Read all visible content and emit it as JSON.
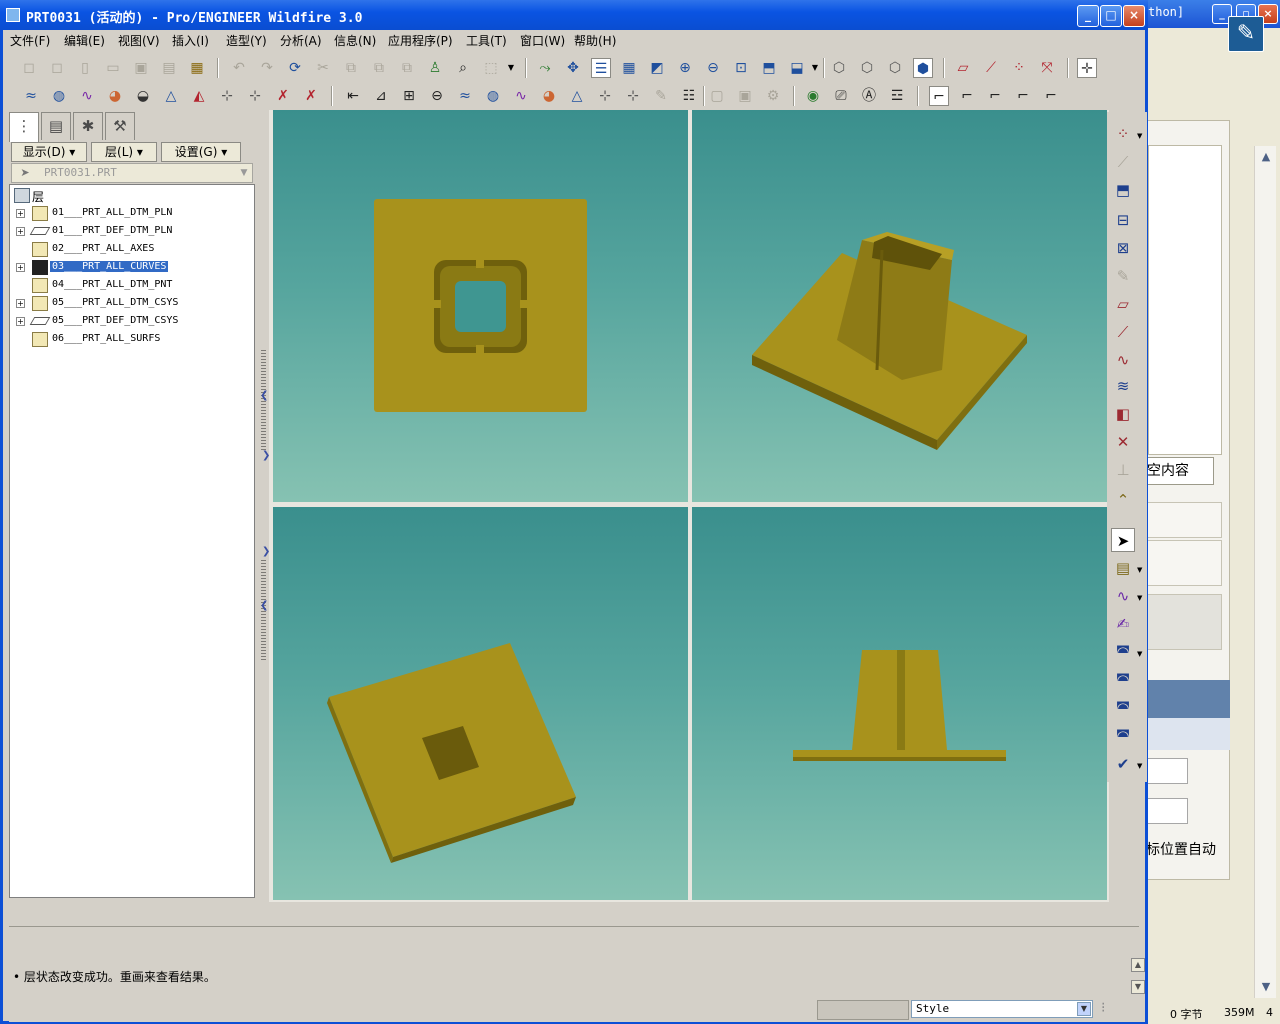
{
  "background_window": {
    "title_fragment": "thon]",
    "clear_text": "空内容",
    "auto_text": "标位置自动",
    "status": [
      "0 字节",
      "359M",
      "4"
    ]
  },
  "window": {
    "title": "PRT0031 (活动的) - Pro/ENGINEER Wildfire 3.0"
  },
  "menu": [
    "文件(F)",
    "编辑(E)",
    "视图(V)",
    "插入(I)",
    "造型(Y)",
    "分析(A)",
    "信息(N)",
    "应用程序(P)",
    "工具(T)",
    "窗口(W)",
    "帮助(H)"
  ],
  "navigator": {
    "buttons": {
      "show": "显示(D)",
      "layer": "层(L)",
      "settings": "设置(G)"
    },
    "model": "PRT0031.PRT",
    "root": "层",
    "layers": [
      {
        "name": "01___PRT_ALL_DTM_PLN",
        "expandable": true
      },
      {
        "name": "01___PRT_DEF_DTM_PLN",
        "expandable": true
      },
      {
        "name": "02___PRT_ALL_AXES",
        "expandable": false
      },
      {
        "name": "03___PRT_ALL_CURVES",
        "expandable": true,
        "selected": true
      },
      {
        "name": "04___PRT_ALL_DTM_PNT",
        "expandable": false
      },
      {
        "name": "05___PRT_ALL_DTM_CSYS",
        "expandable": true
      },
      {
        "name": "05___PRT_DEF_DTM_CSYS",
        "expandable": true
      },
      {
        "name": "06___PRT_ALL_SURFS",
        "expandable": false
      }
    ]
  },
  "message": "• 层状态改变成功。重画来查看结果。",
  "status": {
    "style": "Style"
  },
  "colors": {
    "model": "#a8921c",
    "model_dark": "#7a6a10",
    "viewport_top": "#3a8f8d",
    "viewport_bottom": "#86c2b2",
    "selection": "#316ac5"
  },
  "icons": {
    "top_toolbar": [
      "new-icon",
      "open-icon",
      "save-icon",
      "undo-icon",
      "redo-icon",
      "regenerate-icon",
      "cut-icon",
      "copy-icon",
      "paste-icon",
      "search-icon",
      "zoom-in-icon",
      "zoom-out-icon",
      "refit-icon",
      "orient-icon",
      "shading-icon"
    ],
    "right_toolbar": [
      "datum-point-icon",
      "axis-icon",
      "csys-icon",
      "plane-icon",
      "curve-icon",
      "select-arrow-icon",
      "sketch-icon",
      "check-icon"
    ]
  }
}
